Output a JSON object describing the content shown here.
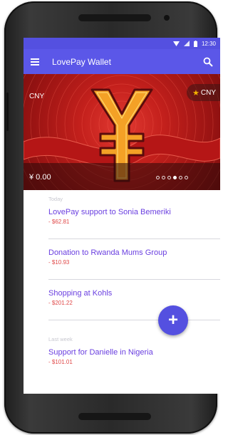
{
  "status_bar": {
    "time": "12:30",
    "icons": [
      "wifi-icon",
      "signal-icon",
      "battery-icon"
    ]
  },
  "app_bar": {
    "title": "LovePay Wallet",
    "menu_icon": "menu-icon",
    "search_icon": "search-icon"
  },
  "card": {
    "currency": "CNY",
    "favorite_currency": "CNY",
    "balance": "¥ 0.00",
    "page_dots": 6,
    "active_dot": 3,
    "colors": {
      "primary": "#5b57e8",
      "card": "#c4201c",
      "accent_text": "#6a3fe0",
      "amount": "#e04848"
    }
  },
  "transactions": {
    "sections": [
      {
        "label": "Today",
        "items": [
          {
            "title": "LovePay support to Sonia Bemeriki",
            "amount": "- $62.81"
          },
          {
            "title": "Donation to Rwanda Mums Group",
            "amount": "- $10.93"
          },
          {
            "title": "Shopping at Kohls",
            "amount": "- $201.22"
          }
        ]
      },
      {
        "label": "Last week",
        "items": [
          {
            "title": "Support for Danielle in Nigeria",
            "amount": "- $101.01"
          }
        ]
      }
    ]
  },
  "fab": {
    "label": "+",
    "icon": "plus-icon"
  }
}
